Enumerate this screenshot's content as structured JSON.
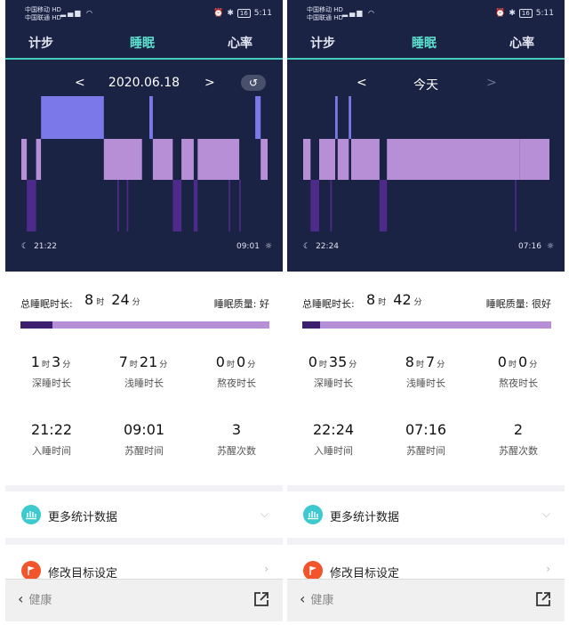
{
  "panels": [
    {
      "status": {
        "carrier1": "中国移动 HD",
        "carrier2": "中国联通 HD",
        "battery": "16",
        "time": "5:11"
      },
      "tabs": [
        "计步",
        "睡眠",
        "心率"
      ],
      "active_tab": 1,
      "date_label": "2020.06.18",
      "nav": {
        "prev": "<",
        "next": ">",
        "next_enabled": true,
        "show_back_button": true,
        "back_icon": "undo-icon"
      },
      "chart_data": {
        "type": "bar",
        "x_start": "21:22",
        "x_end": "09:01",
        "levels": [
          "awake",
          "light",
          "deep"
        ],
        "colors": {
          "awake": "#7b79ea",
          "light": "#b68fd6",
          "deep": "#4e2a8a"
        },
        "segments": [
          {
            "level": "light",
            "start": 0.0,
            "end": 0.022
          },
          {
            "level": "deep",
            "start": 0.022,
            "end": 0.06
          },
          {
            "level": "light",
            "start": 0.06,
            "end": 0.08
          },
          {
            "level": "awake",
            "start": 0.08,
            "end": 0.335
          },
          {
            "level": "light",
            "start": 0.335,
            "end": 0.49
          },
          {
            "level": "deep",
            "start": 0.39,
            "end": 0.396
          },
          {
            "level": "deep",
            "start": 0.428,
            "end": 0.434
          },
          {
            "level": "awake",
            "start": 0.52,
            "end": 0.534
          },
          {
            "level": "light",
            "start": 0.534,
            "end": 0.615
          },
          {
            "level": "deep",
            "start": 0.615,
            "end": 0.65
          },
          {
            "level": "light",
            "start": 0.65,
            "end": 0.7
          },
          {
            "level": "deep",
            "start": 0.7,
            "end": 0.716
          },
          {
            "level": "light",
            "start": 0.716,
            "end": 0.885
          },
          {
            "level": "deep",
            "start": 0.842,
            "end": 0.848
          },
          {
            "level": "deep",
            "start": 0.885,
            "end": 0.891
          },
          {
            "level": "awake",
            "start": 0.95,
            "end": 0.972
          },
          {
            "level": "light",
            "start": 0.972,
            "end": 1.0
          }
        ]
      },
      "summary": {
        "total_label": "总睡眠时长:",
        "total_hours": "8",
        "hour_unit": "时",
        "total_minutes": "24",
        "min_unit": "分",
        "quality_label": "睡眠质量:",
        "quality_value": "好",
        "deep_fraction": 0.13
      },
      "stats": [
        {
          "h": "1",
          "m": "3",
          "label": "深睡时长"
        },
        {
          "h": "7",
          "m": "21",
          "label": "浅睡时长"
        },
        {
          "h": "0",
          "m": "0",
          "label": "熬夜时长"
        }
      ],
      "stats2": [
        {
          "value": "21:22",
          "label": "入睡时间"
        },
        {
          "value": "09:01",
          "label": "苏醒时间"
        },
        {
          "value": "3",
          "label": "苏醒次数"
        }
      ],
      "menu": [
        {
          "label": "更多统计数据",
          "icon": "chart-icon",
          "chevron": "⌵"
        },
        {
          "label": "修改目标设定",
          "icon": "flag-icon",
          "chevron": "›"
        }
      ],
      "bottom": {
        "back_label": "健康",
        "share_icon": "share-icon"
      }
    },
    {
      "status": {
        "carrier1": "中国移动 HD",
        "carrier2": "中国联通 HD",
        "battery": "16",
        "time": "5:11"
      },
      "tabs": [
        "计步",
        "睡眠",
        "心率"
      ],
      "active_tab": 1,
      "date_label": "今天",
      "nav": {
        "prev": "<",
        "next": ">",
        "next_enabled": false,
        "show_back_button": false,
        "back_icon": "undo-icon"
      },
      "chart_data": {
        "type": "bar",
        "x_start": "22:24",
        "x_end": "07:16",
        "levels": [
          "awake",
          "light",
          "deep"
        ],
        "colors": {
          "awake": "#7b79ea",
          "light": "#b68fd6",
          "deep": "#4e2a8a"
        },
        "segments": [
          {
            "level": "light",
            "start": 0.0,
            "end": 0.03
          },
          {
            "level": "deep",
            "start": 0.03,
            "end": 0.065
          },
          {
            "level": "light",
            "start": 0.065,
            "end": 0.13
          },
          {
            "level": "deep",
            "start": 0.11,
            "end": 0.116
          },
          {
            "level": "awake",
            "start": 0.13,
            "end": 0.14
          },
          {
            "level": "light",
            "start": 0.14,
            "end": 0.185
          },
          {
            "level": "awake",
            "start": 0.185,
            "end": 0.195
          },
          {
            "level": "light",
            "start": 0.195,
            "end": 0.31
          },
          {
            "level": "deep",
            "start": 0.31,
            "end": 0.34
          },
          {
            "level": "light",
            "start": 0.34,
            "end": 0.88
          },
          {
            "level": "deep",
            "start": 0.86,
            "end": 0.866
          },
          {
            "level": "light",
            "start": 0.88,
            "end": 1.0
          }
        ]
      },
      "summary": {
        "total_label": "总睡眠时长:",
        "total_hours": "8",
        "hour_unit": "时",
        "total_minutes": "42",
        "min_unit": "分",
        "quality_label": "睡眠质量:",
        "quality_value": "很好",
        "deep_fraction": 0.07
      },
      "stats": [
        {
          "h": "0",
          "m": "35",
          "label": "深睡时长"
        },
        {
          "h": "8",
          "m": "7",
          "label": "浅睡时长"
        },
        {
          "h": "0",
          "m": "0",
          "label": "熬夜时长"
        }
      ],
      "stats2": [
        {
          "value": "22:24",
          "label": "入睡时间"
        },
        {
          "value": "07:16",
          "label": "苏醒时间"
        },
        {
          "value": "2",
          "label": "苏醒次数"
        }
      ],
      "menu": [
        {
          "label": "更多统计数据",
          "icon": "chart-icon",
          "chevron": "⌵"
        },
        {
          "label": "修改目标设定",
          "icon": "flag-icon",
          "chevron": "›"
        }
      ],
      "bottom": {
        "back_label": "健康",
        "share_icon": "share-icon"
      }
    }
  ]
}
